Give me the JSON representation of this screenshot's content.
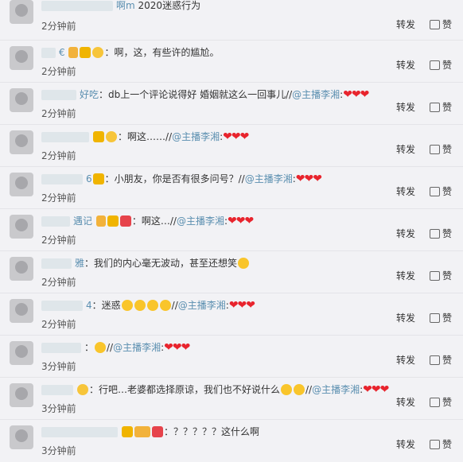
{
  "comments": [
    {
      "username_tail": "啊m",
      "text": "2020迷惑行为",
      "time": "2分钟前",
      "badges": [],
      "hearts": ""
    },
    {
      "username_tail": "€",
      "text": "：啊，这，有些许的尴尬。",
      "time": "2分钟前",
      "badges": [
        "vip",
        "gold",
        "bulb"
      ],
      "hearts": ""
    },
    {
      "username_tail": "好吃",
      "text": "：db上一个评论说得好 婚姻就这么一回事儿//",
      "mention": "@主播李湘",
      "mention_suffix": ":",
      "time": "2分钟前",
      "badges": [],
      "hearts": "❤❤❤"
    },
    {
      "username_tail": "",
      "text": "：啊这……//",
      "mention": "@主播李湘",
      "mention_suffix": ":",
      "time": "2分钟前",
      "badges": [
        "gold",
        "bulb"
      ],
      "hearts": "❤❤❤"
    },
    {
      "username_tail": "6",
      "text": "：小朋友，你是否有很多问号？//",
      "mention": "@主播李湘",
      "mention_suffix": ":",
      "time": "2分钟前",
      "badges": [
        "gold"
      ],
      "hearts": "❤❤❤"
    },
    {
      "username_tail": "遇记",
      "text": "：啊这…//",
      "mention": "@主播李湘",
      "mention_suffix": ":",
      "time": "2分钟前",
      "badges": [
        "vip",
        "gold",
        "red"
      ],
      "hearts": "❤❤❤"
    },
    {
      "username_tail": "雅",
      "text": "：我们的内心毫无波动，甚至还想笑",
      "time": "2分钟前",
      "badges": [],
      "emojis": 1,
      "hearts": ""
    },
    {
      "username_tail": "4",
      "text": "：迷惑",
      "after_emojis": "//",
      "mention": "@主播李湘",
      "mention_suffix": ":",
      "time": "2分钟前",
      "badges": [],
      "emojis": 4,
      "hearts": "❤❤❤"
    },
    {
      "username_tail": "",
      "text": "：",
      "after_emojis": "//",
      "mention": "@主播李湘",
      "mention_suffix": ":",
      "time": "3分钟前",
      "badges": [],
      "emojis": 1,
      "hearts": "❤❤❤"
    },
    {
      "username_tail": "",
      "text": "：行吧…老婆都选择原谅，我们也不好说什么",
      "after_emojis": "//",
      "mention": "@主播李湘",
      "mention_suffix": ":",
      "time": "3分钟前",
      "badges": [
        "bulb"
      ],
      "emojis": 2,
      "hearts": "❤❤❤"
    },
    {
      "username_tail": "",
      "text": "：？？？？？这什么啊",
      "time": "3分钟前",
      "badges": [
        "gold",
        "vip",
        "red"
      ],
      "hearts": ""
    }
  ],
  "actions": {
    "forward_label": "转发",
    "like_label": "赞"
  },
  "colors": {
    "mention": "#5b8fb0",
    "heart": "#e8242d",
    "background": "#f2f2f5"
  }
}
